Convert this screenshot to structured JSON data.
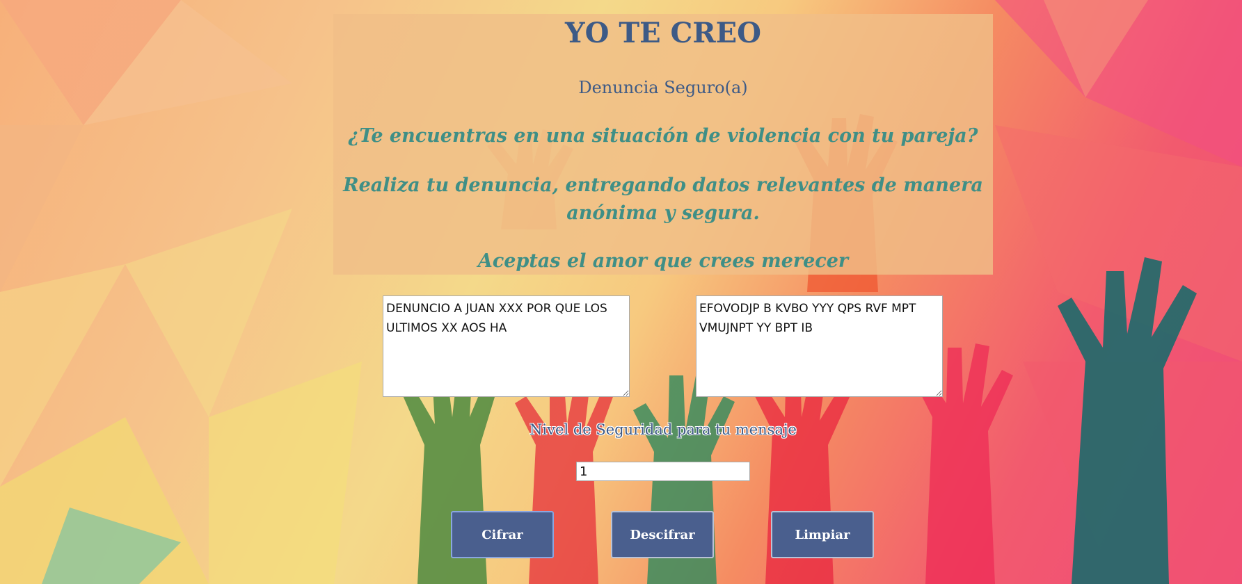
{
  "header": {
    "title": "YO TE CREO",
    "subtitle": "Denuncia Seguro(a)"
  },
  "messages": {
    "question": "¿Te encuentras en una situación de violencia con tu pareja?",
    "instruction": "Realiza tu denuncia, entregando datos relevantes de manera anónima y segura.",
    "slogan": "Aceptas el amor que crees merecer"
  },
  "form": {
    "plain_text_value": "DENUNCIO A JUAN XXX POR QUE LOS ULTIMOS XX AOS HA",
    "cipher_text_value": "EFOVODJP B KVBO YYY QPS RVF MPT VMUJNPT YY BPT IB",
    "security_label": "Nivel de Seguridad para tu mensaje",
    "security_value": "1"
  },
  "buttons": {
    "encrypt": "Cifrar",
    "decrypt": "Descifrar",
    "clear": "Limpiar"
  },
  "colors": {
    "title": "#3d5a86",
    "accent_text": "#3f8f86",
    "button_bg": "#4a5f8e",
    "panel_bg": "#f0be87"
  }
}
